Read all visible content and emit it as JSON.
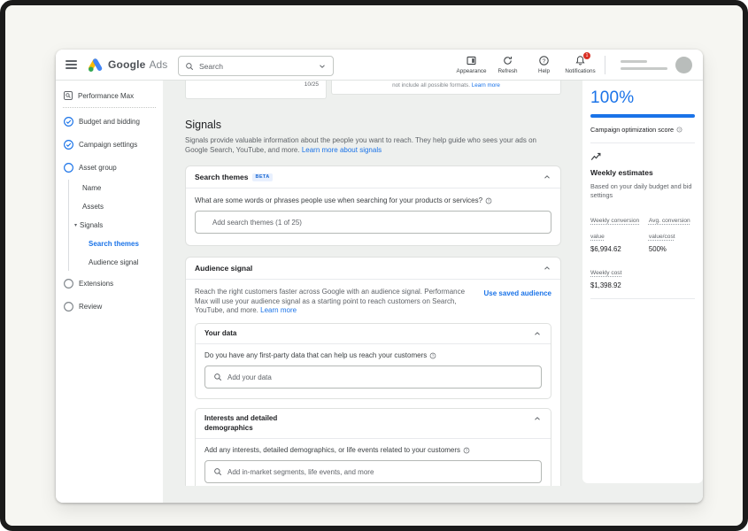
{
  "header": {
    "logo": {
      "google": "Google",
      "ads": "Ads"
    },
    "search_placeholder": "Search",
    "actions": [
      {
        "label": "Appearance"
      },
      {
        "label": "Refresh"
      },
      {
        "label": "Help"
      },
      {
        "label": "Notifications",
        "badge": "1"
      }
    ]
  },
  "sidebar": {
    "campaign_type": "Performance Max",
    "steps": [
      {
        "label": "Budget and bidding",
        "state": "complete"
      },
      {
        "label": "Campaign settings",
        "state": "complete"
      },
      {
        "label": "Asset group",
        "state": "current"
      },
      {
        "label": "Extensions",
        "state": "todo"
      },
      {
        "label": "Review",
        "state": "todo"
      }
    ],
    "asset_group_subitems": [
      {
        "label": "Name"
      },
      {
        "label": "Assets"
      },
      {
        "label": "Signals"
      }
    ],
    "signals_subitems": [
      {
        "label": "Search themes",
        "active": true
      },
      {
        "label": "Audience signal",
        "active": false
      }
    ]
  },
  "main": {
    "previous_section": {
      "char_counter": "10/25",
      "note_text": "not include all possible formats.",
      "note_link": "Learn more"
    },
    "signals_section": {
      "title": "Signals",
      "description": "Signals provide valuable information about the people you want to reach. They help guide who sees your ads on Google Search, YouTube, and more.",
      "learn_more_link": "Learn more about signals"
    },
    "search_themes_card": {
      "title": "Search themes",
      "beta_badge": "BETA",
      "question": "What are some words or phrases people use when searching for your products or services?",
      "input_placeholder": "Add search themes (1 of 25)"
    },
    "audience_signal_card": {
      "title": "Audience signal",
      "description": "Reach the right customers faster across Google with an audience signal. Performance Max will use your audience signal as a starting point to reach customers on Search, YouTube, and more.",
      "learn_more_link": "Learn more",
      "use_saved_audience_link": "Use saved audience",
      "your_data_card": {
        "title": "Your data",
        "question": "Do you have any first-party data that can help us reach your customers",
        "input_placeholder": "Add your data"
      },
      "interests_card": {
        "title": "Interests and detailed demographics",
        "question": "Add any interests, detailed demographics, or life events related to your customers",
        "input_placeholder": "Add in-market segments, life events, and more"
      }
    }
  },
  "score_panel": {
    "score": "100%",
    "score_label": "Campaign optimization score",
    "weekly_estimates": {
      "title": "Weekly estimates",
      "subtitle": "Based on your daily budget and bid settings",
      "metrics": [
        {
          "label": "Weekly conversion value",
          "value": "$6,994.62"
        },
        {
          "label": "Avg. conversion value/cost",
          "value": "500%"
        },
        {
          "label": "Weekly cost",
          "value": "$1,398.92"
        }
      ]
    }
  },
  "colors": {
    "accent_blue": "#1a73e8",
    "badge_red": "#d93025",
    "beta_bg": "#e8f0fe",
    "beta_text": "#1967d2"
  }
}
